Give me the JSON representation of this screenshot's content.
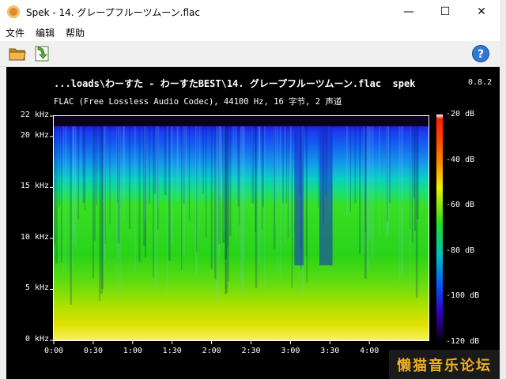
{
  "window": {
    "title": "Spek - 14. グレープフルーツムーン.flac",
    "minimize_label": "—",
    "maximize_label": "☐",
    "close_label": "✕"
  },
  "menu": {
    "items": [
      "文件",
      "编辑",
      "帮助"
    ]
  },
  "toolbar": {
    "open_icon": "folder-open-icon",
    "save_icon": "save-export-icon",
    "help_icon": "help-icon"
  },
  "spek": {
    "file_title": "...loads\\わーすた - わーすたBEST\\14. グレープフルーツムーン.flac",
    "app_name": "spek",
    "version": "0.8.2",
    "info": "FLAC (Free Lossless Audio Codec), 44100 Hz, 16 字节, 2 声道"
  },
  "chart_data": {
    "type": "heatmap",
    "y_ticks": [
      "22 kHz",
      "20 kHz",
      "15 kHz",
      "10 kHz",
      "5 kHz",
      "0 kHz"
    ],
    "y_values_khz": [
      22,
      20,
      15,
      10,
      5,
      0
    ],
    "x_ticks": [
      "0:00",
      "0:30",
      "1:00",
      "1:30",
      "2:00",
      "2:30",
      "3:00",
      "3:30",
      "4:00"
    ],
    "x_values_s": [
      0,
      30,
      60,
      90,
      120,
      150,
      180,
      210,
      240
    ],
    "xlim": [
      0,
      285
    ],
    "ylim": [
      0,
      22
    ],
    "color_scale_ticks": [
      "-20 dB",
      "-40 dB",
      "-60 dB",
      "-80 dB",
      "-100 dB",
      "-120 dB"
    ],
    "color_scale_values_db": [
      -20,
      -40,
      -60,
      -80,
      -100,
      -120
    ],
    "cutoff_khz": 21,
    "quiet_segments_s": [
      [
        183,
        190
      ],
      [
        202,
        212
      ]
    ]
  },
  "watermark": {
    "text": "懒猫音乐论坛"
  }
}
